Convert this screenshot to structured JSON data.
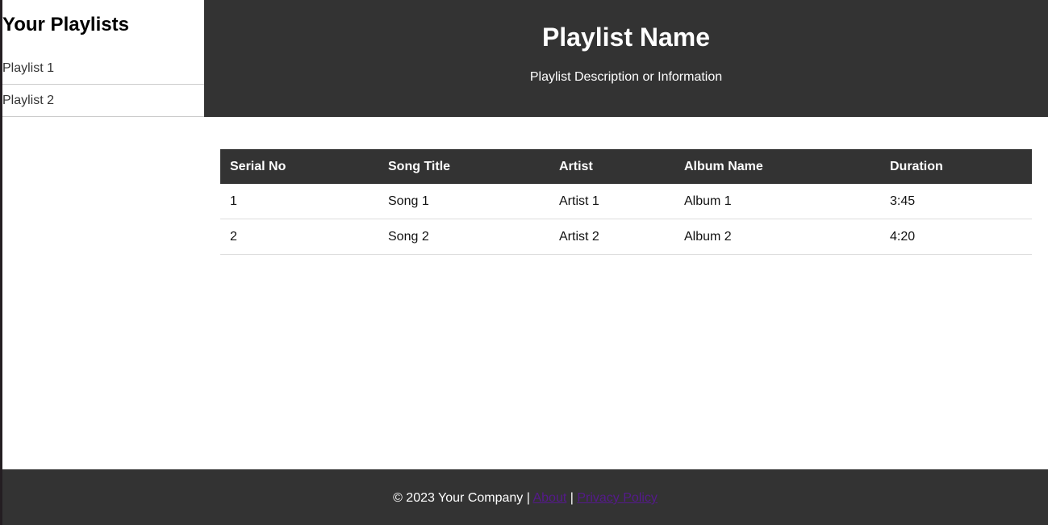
{
  "sidebar": {
    "title": "Your Playlists",
    "items": [
      {
        "label": "Playlist 1"
      },
      {
        "label": "Playlist 2"
      }
    ]
  },
  "header": {
    "title": "Playlist Name",
    "subtitle": "Playlist Description or Information"
  },
  "table": {
    "headers": [
      "Serial No",
      "Song Title",
      "Artist",
      "Album Name",
      "Duration"
    ],
    "rows": [
      {
        "serial": "1",
        "title": "Song 1",
        "artist": "Artist 1",
        "album": "Album 1",
        "duration": "3:45"
      },
      {
        "serial": "2",
        "title": "Song 2",
        "artist": "Artist 2",
        "album": "Album 2",
        "duration": "4:20"
      }
    ]
  },
  "footer": {
    "copyright": "© 2023 Your Company |",
    "separator": "|",
    "links": [
      {
        "label": "About"
      },
      {
        "label": "Privacy Policy"
      }
    ]
  },
  "colors": {
    "dark": "#333333",
    "link": "#551a8b",
    "background": "#ffffff"
  }
}
